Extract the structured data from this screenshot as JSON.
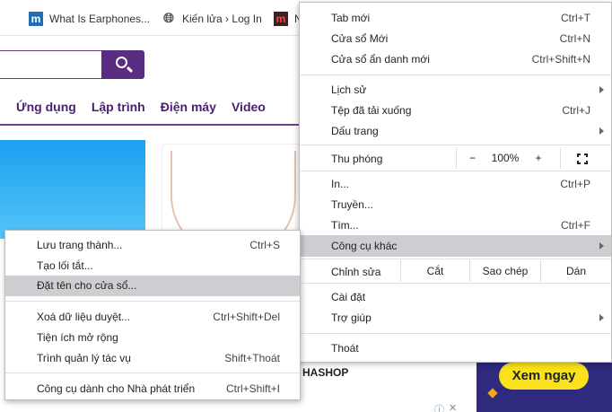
{
  "bookmarks": [
    {
      "label": "What Is Earphones...",
      "icon": "m-favicon"
    },
    {
      "label": "Kiến lửa › Log In",
      "icon": "globe-icon"
    },
    {
      "label": "N",
      "icon": "m-red-favicon"
    }
  ],
  "site": {
    "nav": [
      "Ứng dụng",
      "Lập trình",
      "Điện máy",
      "Video"
    ],
    "shop_label": "HASHOP",
    "ad_button": "Xem ngay",
    "ad_info": "ⓘ",
    "ad_close": "✕"
  },
  "main_menu": {
    "new_tab": {
      "label": "Tab mới",
      "shortcut": "Ctrl+T"
    },
    "new_window": {
      "label": "Cửa sổ Mới",
      "shortcut": "Ctrl+N"
    },
    "incognito": {
      "label": "Cửa sổ ẩn danh mới",
      "shortcut": "Ctrl+Shift+N"
    },
    "history": {
      "label": "Lịch sử"
    },
    "downloads": {
      "label": "Tệp đã tải xuống",
      "shortcut": "Ctrl+J"
    },
    "bookmarks": {
      "label": "Dấu trang"
    },
    "zoom": {
      "label": "Thu phóng",
      "minus": "−",
      "value": "100%",
      "plus": "+"
    },
    "print": {
      "label": "In...",
      "shortcut": "Ctrl+P"
    },
    "cast": {
      "label": "Truyền..."
    },
    "find": {
      "label": "Tìm...",
      "shortcut": "Ctrl+F"
    },
    "more_tools": {
      "label": "Công cụ khác"
    },
    "edit": {
      "label": "Chỉnh sửa",
      "cut": "Cắt",
      "copy": "Sao chép",
      "paste": "Dán"
    },
    "settings": {
      "label": "Cài đặt"
    },
    "help": {
      "label": "Trợ giúp"
    },
    "exit": {
      "label": "Thoát"
    }
  },
  "sub_menu": {
    "save_page": {
      "label": "Lưu trang thành...",
      "shortcut": "Ctrl+S"
    },
    "create_shortcut": {
      "label": "Tạo lối tắt..."
    },
    "name_window": {
      "label": "Đặt tên cho cửa sổ..."
    },
    "clear_data": {
      "label": "Xoá dữ liệu duyệt...",
      "shortcut": "Ctrl+Shift+Del"
    },
    "extensions": {
      "label": "Tiện ích mở rộng"
    },
    "task_manager": {
      "label": "Trình quản lý tác vụ",
      "shortcut": "Shift+Thoát"
    },
    "dev_tools": {
      "label": "Công cụ dành cho Nhà phát triển",
      "shortcut": "Ctrl+Shift+I"
    }
  },
  "colors": {
    "accent": "#5b2d82",
    "highlight": "#cfcdd2",
    "ad_yellow": "#f9e21b"
  }
}
